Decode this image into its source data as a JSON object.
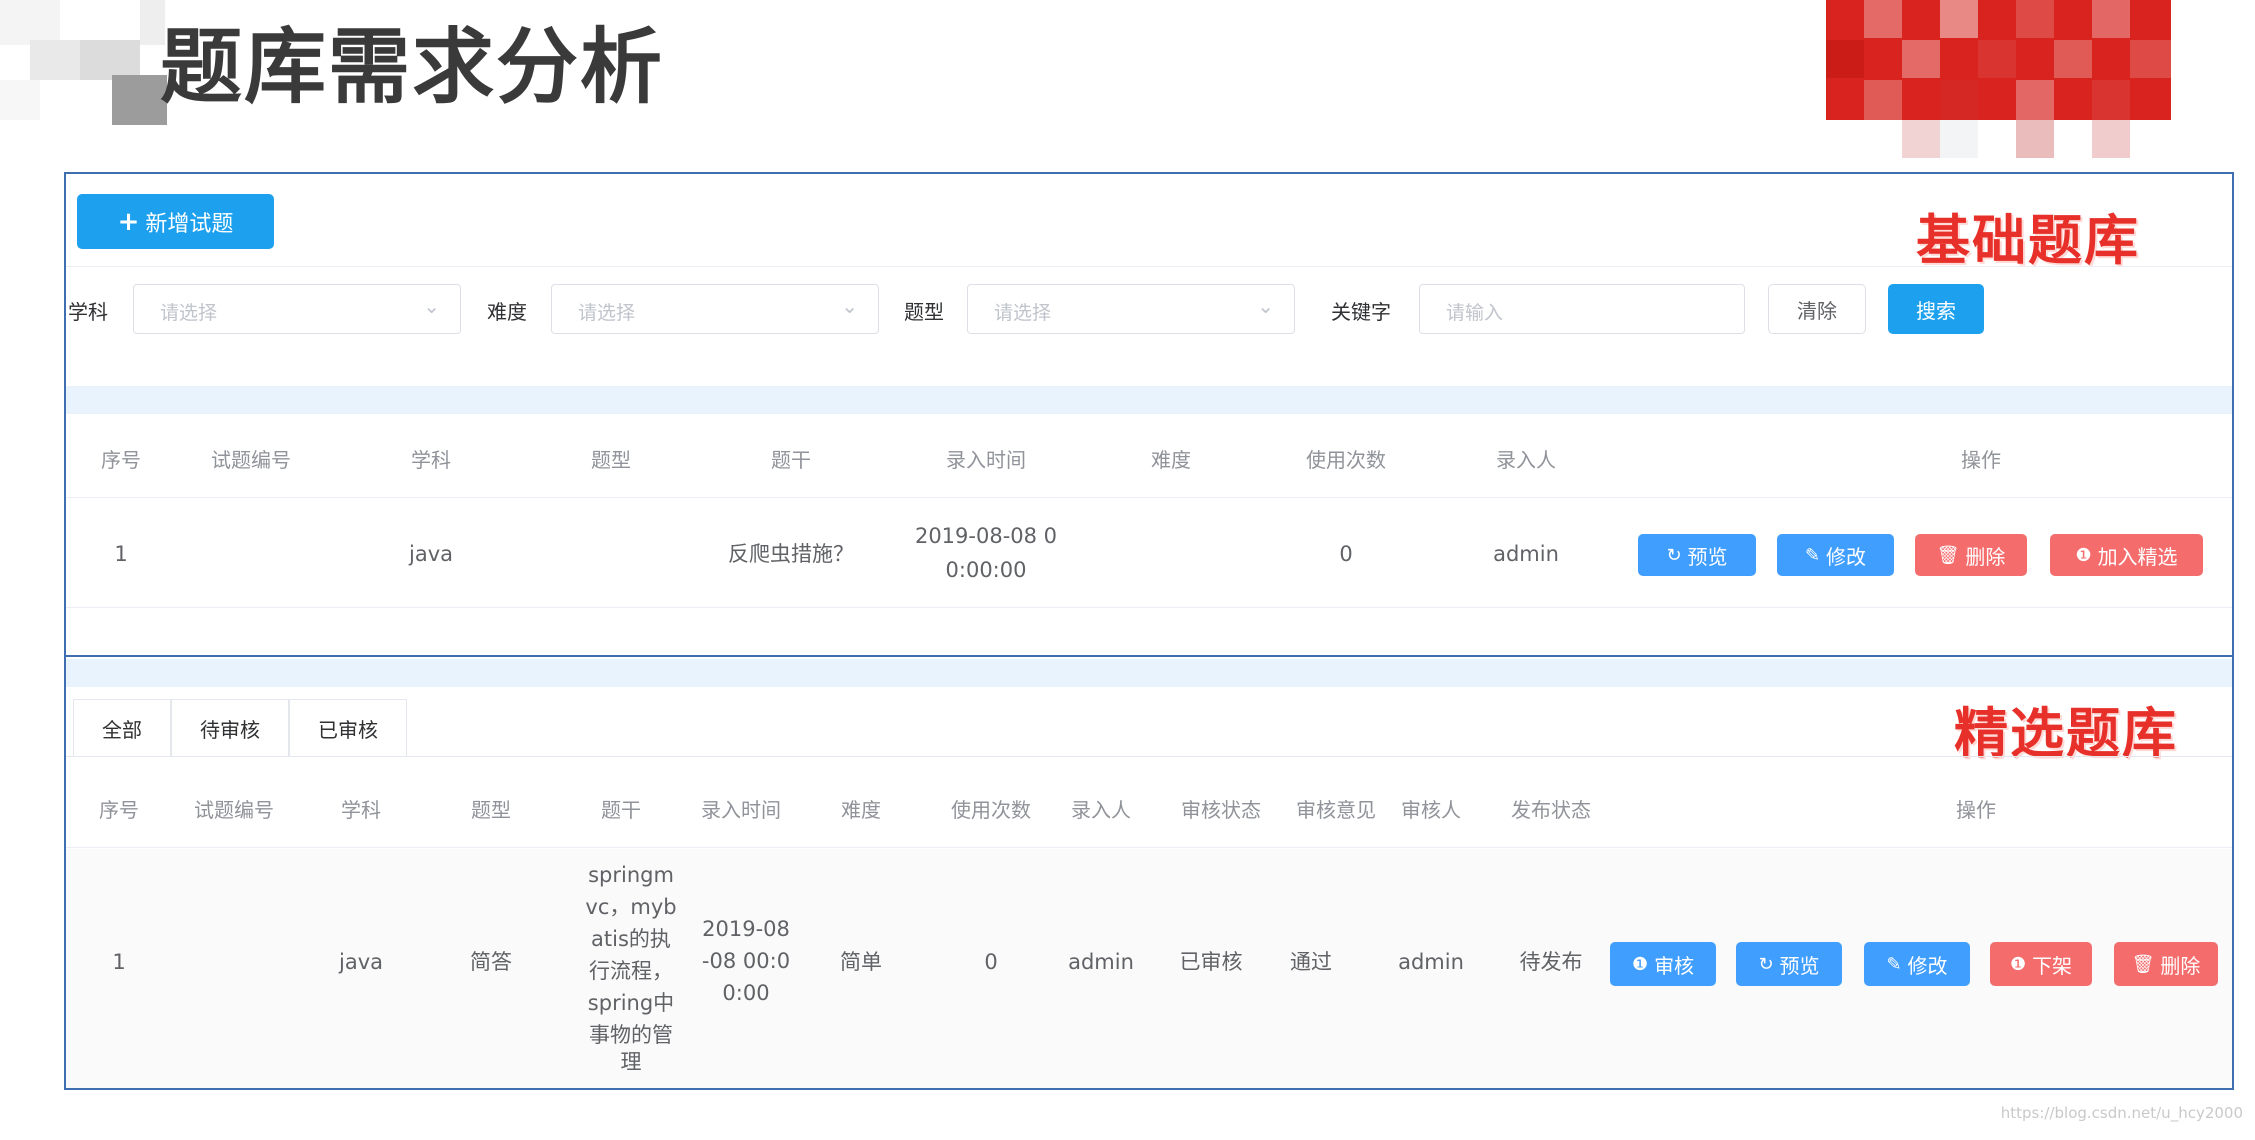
{
  "slide": {
    "title": "题库需求分析",
    "watermark": "https://blog.csdn.net/u_hcy2000"
  },
  "basic": {
    "section_label": "基础题库",
    "add_button": "新增试题",
    "filters": {
      "subject_label": "学科",
      "subject_placeholder": "请选择",
      "difficulty_label": "难度",
      "difficulty_placeholder": "请选择",
      "type_label": "题型",
      "type_placeholder": "请选择",
      "keyword_label": "关键字",
      "keyword_placeholder": "请输入",
      "clear_button": "清除",
      "search_button": "搜索"
    },
    "columns": [
      "序号",
      "试题编号",
      "学科",
      "题型",
      "题干",
      "录入时间",
      "难度",
      "使用次数",
      "录入人",
      "操作"
    ],
    "row": {
      "index": "1",
      "code": "",
      "subject": "java",
      "type": "",
      "stem": "反爬虫措施？",
      "time_line1": "2019-08-08 0",
      "time_line2": "0:00:00",
      "difficulty": "",
      "uses": "0",
      "creator": "admin"
    },
    "actions": {
      "preview": "预览",
      "edit": "修改",
      "delete": "删除",
      "add_featured": "加入精选"
    }
  },
  "featured": {
    "section_label": "精选题库",
    "tabs": [
      "全部",
      "待审核",
      "已审核"
    ],
    "columns": [
      "序号",
      "试题编号",
      "学科",
      "题型",
      "题干",
      "录入时间",
      "难度",
      "使用次数",
      "录入人",
      "审核状态",
      "审核意见",
      "审核人",
      "发布状态",
      "操作"
    ],
    "row": {
      "index": "1",
      "code": "",
      "subject": "java",
      "type": "简答",
      "stem_lines": [
        "springm",
        "vc，myb",
        "atis的执",
        "行流程，",
        "spring中",
        "事物的管",
        "理"
      ],
      "time_lines": [
        "2019-08",
        "-08 00:0",
        "0:00"
      ],
      "difficulty": "简单",
      "uses": "0",
      "creator": "admin",
      "review_status": "已审核",
      "review_opinion": "通过",
      "reviewer": "admin",
      "publish_status": "待发布"
    },
    "actions": {
      "review": "审核",
      "preview": "预览",
      "edit": "修改",
      "unpublish": "下架",
      "delete": "删除"
    }
  },
  "colors": {
    "primary": "#409eff",
    "danger": "#f56c6c",
    "frame_border": "#3f6fb0",
    "label_red": "#e8302a"
  }
}
